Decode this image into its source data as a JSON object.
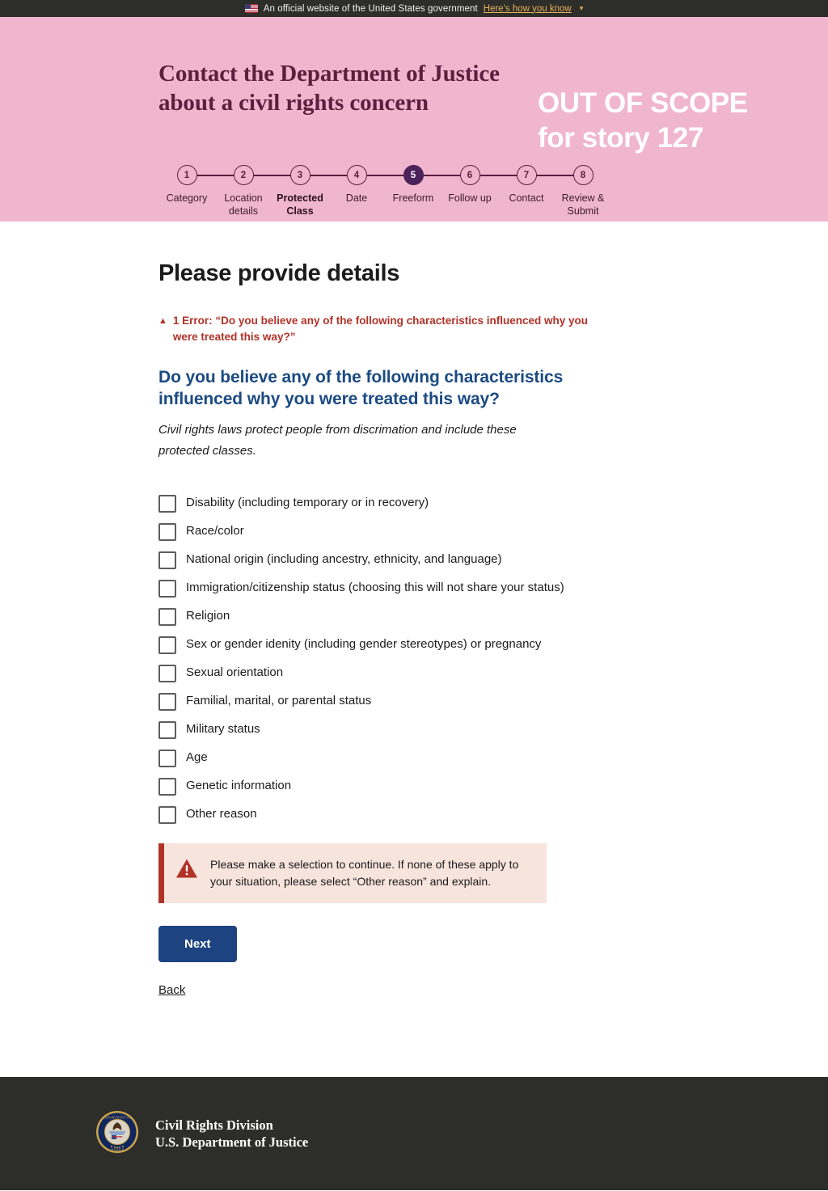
{
  "banner": {
    "flag_icon": "us-flag-icon",
    "text": "An official website of the United States government",
    "link_label": "Here's how you know",
    "chevron_icon": "chevron-down-icon"
  },
  "header": {
    "site_title_line1": "Contact the Department of Justice",
    "site_title_line2": "about a civil rights concern",
    "background_color": "#f0b6cd",
    "title_color": "#5c1f3e",
    "overlay_line1": "OUT OF SCOPE",
    "overlay_line2": "for story 127"
  },
  "stepper": {
    "active_step": 5,
    "current_label_step": 3,
    "active_circle_color": "#4b2259",
    "steps": [
      {
        "number": "1",
        "label": "Category"
      },
      {
        "number": "2",
        "label": "Location details"
      },
      {
        "number": "3",
        "label": "Protected Class"
      },
      {
        "number": "4",
        "label": "Date"
      },
      {
        "number": "5",
        "label": "Freeform"
      },
      {
        "number": "6",
        "label": "Follow up"
      },
      {
        "number": "7",
        "label": "Contact"
      },
      {
        "number": "8",
        "label": "Review & Submit"
      }
    ]
  },
  "main": {
    "page_title": "Please provide details",
    "error_summary": {
      "icon": "warning-triangle-icon",
      "text": "1 Error: “Do you believe any of the following characteristics influenced why you were treated this way?”",
      "color": "#b23228"
    },
    "question": {
      "heading": "Do you believe any of the following characteristics influenced why you were treated this way?",
      "heading_color": "#1b4a82",
      "hint": "Civil rights laws protect people from discrimation and include these protected classes."
    },
    "checkboxes": [
      {
        "label": "Disability (including temporary or in recovery)",
        "checked": false
      },
      {
        "label": "Race/color",
        "checked": false
      },
      {
        "label": "National origin (including ancestry, ethnicity, and language)",
        "checked": false
      },
      {
        "label": "Immigration/citizenship status (choosing this will not share your status)",
        "checked": false
      },
      {
        "label": "Religion",
        "checked": false
      },
      {
        "label": "Sex or gender idenity (including gender stereotypes) or pregnancy",
        "checked": false
      },
      {
        "label": "Sexual orientation",
        "checked": false
      },
      {
        "label": "Familial, marital, or parental status",
        "checked": false
      },
      {
        "label": "Military status",
        "checked": false
      },
      {
        "label": "Age",
        "checked": false
      },
      {
        "label": "Genetic information",
        "checked": false
      },
      {
        "label": "Other reason",
        "checked": false
      }
    ],
    "alert": {
      "icon": "alert-triangle-icon",
      "text": "Please make a selection to continue. If none of these apply to your situation, please select “Other reason” and explain.",
      "background_color": "#f7e4dd",
      "border_color": "#b23228"
    },
    "next_button": "Next",
    "next_button_color": "#1d4480",
    "back_link": "Back"
  },
  "footer": {
    "seal_icon": "doj-seal-icon",
    "line1": "Civil Rights Division",
    "line2": "U.S. Department of Justice",
    "background_color": "#2d2e29"
  }
}
